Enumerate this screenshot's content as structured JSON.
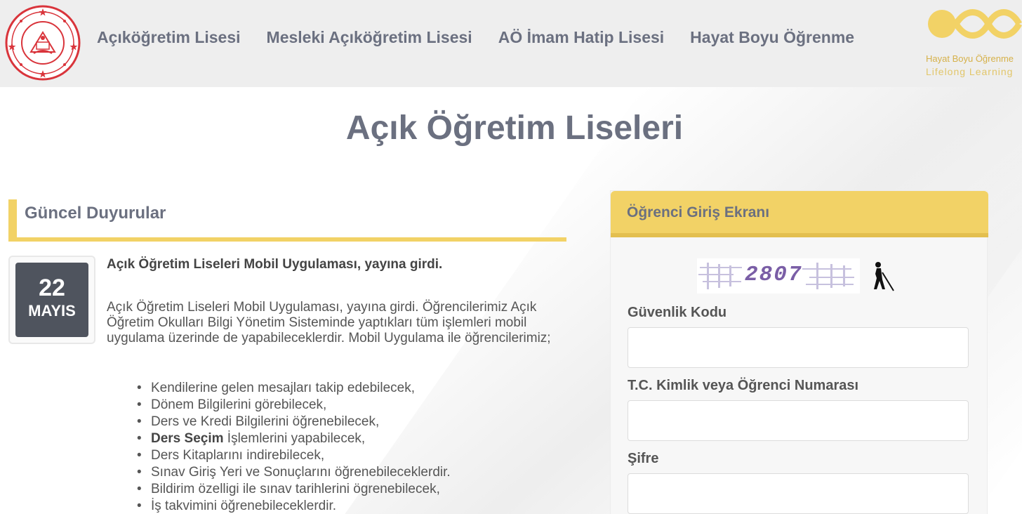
{
  "header": {
    "nav": [
      {
        "label": "Açıköğretim Lisesi"
      },
      {
        "label": "Mesleki Açıköğretim Lisesi"
      },
      {
        "label": "AÖ İmam Hatip Lisesi"
      },
      {
        "label": "Hayat Boyu Öğrenme"
      }
    ],
    "hbo_logo": {
      "line1": "Hayat Boyu Öğrenme",
      "line2": "Lifelong Learning"
    },
    "meb_logo_icon": "meb-emblem-icon"
  },
  "page_title": "Açık Öğretim Liseleri",
  "announcements": {
    "heading": "Güncel Duyurular",
    "item": {
      "day": "22",
      "month": "MAYIS",
      "title": "Açık Öğretim Liseleri Mobil Uygulaması, yayına girdi.",
      "body": "Açık Öğretim Liseleri Mobil Uygulaması, yayına girdi. Öğrencilerimiz Açık Öğretim Okulları Bilgi Yönetim Sisteminde yaptıkları tüm işlemleri mobil uygulama üzerinde de yapabileceklerdir. Mobil Uygulama ile öğrencilerimiz;",
      "list": [
        {
          "text": "Kendilerine gelen mesajları takip edebilecek,"
        },
        {
          "text": "Dönem Bilgilerini görebilecek,"
        },
        {
          "text": "Ders ve Kredi Bilgilerini öğrenebilecek,"
        },
        {
          "bold": "Ders Seçim",
          "text": " İşlemlerini yapabilecek,"
        },
        {
          "text": "Ders Kitaplarını indirebilecek,"
        },
        {
          "text": "Sınav Giriş Yeri ve Sonuçlarını öğrenebileceklerdir."
        },
        {
          "text": "Bildirim özelligi ile sınav tarihlerini ögrenebilecek,"
        },
        {
          "text": "İş takvimini öğrenebileceklerdir."
        }
      ]
    }
  },
  "login": {
    "heading": "Öğrenci Giriş Ekranı",
    "captcha_text": "2807",
    "accessibility_icon": "blind-person-icon",
    "security_code_label": "Güvenlik Kodu",
    "security_code_value": "",
    "id_label": "T.C. Kimlik veya Öğrenci Numarası",
    "id_value": "",
    "password_label": "Şifre",
    "password_value": ""
  },
  "colors": {
    "accent_yellow": "#f2d266",
    "nav_text": "#6b7080",
    "date_box": "#4f545e"
  }
}
